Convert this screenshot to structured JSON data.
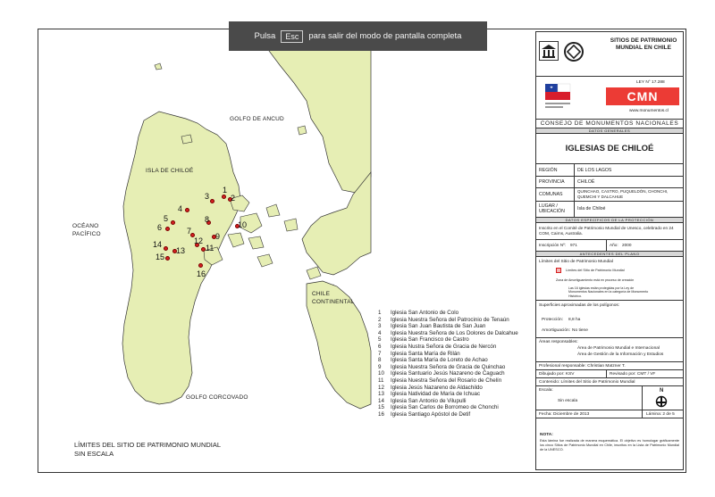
{
  "banner": {
    "pre": "Pulsa",
    "key": "Esc",
    "post": "para salir del modo de pantalla completa"
  },
  "map": {
    "land_color": "#e6eeb4",
    "sea_color": "#ffffff",
    "marker_color": "#d62020",
    "labels": {
      "golfo_ancud": "GOLFO DE ANCUD",
      "isla_chiloe": "ISLA DE CHILOÉ",
      "oceano_1": "OCÉANO",
      "oceano_2": "PACÍFICO",
      "chile_1": "CHILE",
      "chile_2": "CONTINENTAL",
      "golfo_corcovado": "GOLFO CORCOVADO"
    },
    "markers": [
      "1",
      "2",
      "3",
      "4",
      "5",
      "6",
      "7",
      "8",
      "9",
      "10",
      "11",
      "12",
      "13",
      "14",
      "15",
      "16"
    ]
  },
  "legend": [
    {
      "n": "1",
      "t": "Iglesia San Antonio de Colo"
    },
    {
      "n": "2",
      "t": "Iglesia Nuestra Señora del Patrocinio de Tenaún"
    },
    {
      "n": "3",
      "t": "Iglesia San Juan Bautista de San Juan"
    },
    {
      "n": "4",
      "t": "Iglesia Nuestra Señora de Los Dolores de Dalcahue"
    },
    {
      "n": "5",
      "t": "Iglesia San Francisco de Castro"
    },
    {
      "n": "6",
      "t": "Iglesia Nustra Señora de Gracia de Nercón"
    },
    {
      "n": "7",
      "t": "Iglesia Santa María de Rilán"
    },
    {
      "n": "8",
      "t": "Iglesia Santa María de Loreto de Achao"
    },
    {
      "n": "9",
      "t": "Iglesia Nuestra Señora de Gracia de Quinchao"
    },
    {
      "n": "10",
      "t": "Iglesia Santuario Jesús Nazareno de Caguach"
    },
    {
      "n": "11",
      "t": "Iglesia Nuestra Señora del Rosario de Chelín"
    },
    {
      "n": "12",
      "t": "Iglesia Jesús Nazareno de Aldachildo"
    },
    {
      "n": "13",
      "t": "Iglesia Natividad de María de Ichuac"
    },
    {
      "n": "14",
      "t": "Iglesia San Antonio de Vilupulli"
    },
    {
      "n": "15",
      "t": "Iglesia San Carlos de Borromeo de Chonchi"
    },
    {
      "n": "16",
      "t": "Iglesia Santiago Apóstol de Detif"
    }
  ],
  "limites": {
    "title": "LÍMITES DEL SITIO DE PATRIMONIO MUNDIAL",
    "scale": "SIN ESCALA"
  },
  "panel": {
    "sitios_title": "SITIOS DE PATRIMONIO MUNDIAL EN CHILE",
    "ley": "LEY N° 17.288",
    "cmn": "CMN",
    "web": "www.monumentos.cl",
    "consejo": "CONSEJO DE MONUMENTOS NACIONALES",
    "datos_generales": "DATOS GENERALES",
    "main_title": "IGLESIAS DE CHILOÉ",
    "region_label": "REGIÓN",
    "region_value": "DE LOS LAGOS",
    "provincia_label": "PROVINCIA",
    "provincia_value": "CHILOÉ",
    "comunas_label": "COMUNAS",
    "comunas_value": "QUINCHAO, CASTRO, PUQUELDÓN, CHONCHI, QUEMCHI Y DALCAHUE",
    "lugar_label": "LUGAR / UBICACIÓN",
    "lugar_value": "Isla de Chiloé",
    "datos_proteccion": "DATOS ESPECÍFICOS DE LA PROTECCIÓN",
    "inscrito": "Inscrito en el Comité de Patrimonio Mundial de Unesco, celebrado en 24 COM, Cairns, Australia.",
    "inscripcion_label": "Inscripción Nº:",
    "inscripcion_value": "971",
    "anio_label": "Año:",
    "anio_value": "2000",
    "antecedentes": "ANTECEDENTES DEL PLANO",
    "limites_label": "Límites del Sitio de Patrimonio Mundial",
    "sym_limite": "Límites del Sitio de Patrimonio Mundial",
    "zona": "Zona de Amortiguamiento está en proceso de creación",
    "iglesias_note": "Las 16 iglesias están protegidas por la Ley de Monumentos Nacionales en la categoría de Monumento Histórico.",
    "superficies": "Superficies aproximadas de los polígonos:",
    "proteccion_label": "Protección:",
    "proteccion_value": "8,8 ha",
    "amort_label": "Amortiguación:",
    "amort_value": "No tiene",
    "areas_label": "Áreas responsables:",
    "area1": "Área de Patrimonio Mundial e Internacional",
    "area2": "Área de Gestión de la Información y Estudios",
    "prof": "Profesional responsable: Christian Matzner T.",
    "dibujado": "Dibujado por: KSV",
    "revisado": "Revisado por: CMT / VF",
    "contenido": "Contenido: Límites del Sitio de Patrimonio Mundial",
    "escala_label": "Escala:",
    "escala_value": "Sin escala",
    "norte": "N",
    "fecha": "Fecha: Diciembre de 2013",
    "lamina": "Lámina:   2 de 5",
    "nota_label": "NOTA:",
    "nota_text": "Esta lámina fue realizada de manera esquemática. El objetivo es homologar gráficamente los cinco Sitios de Patrimonio Mundial en Chile, inscritos en la Lista de Patrimonio Mundial de la UNESCO."
  }
}
